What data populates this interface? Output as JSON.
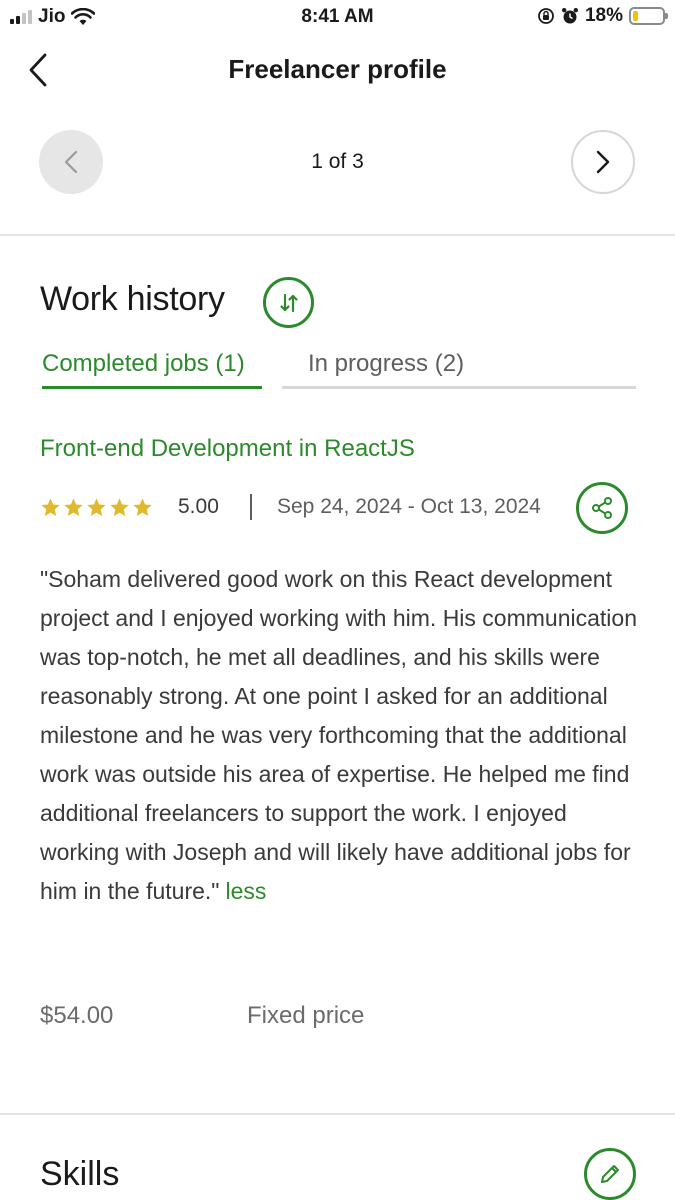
{
  "status_bar": {
    "carrier": "Jio",
    "time": "8:41 AM",
    "battery_percent": "18%",
    "battery_level": 0.18,
    "icons": [
      "signal-icon",
      "wifi-icon",
      "orientation-lock-icon",
      "alarm-icon",
      "battery-icon"
    ]
  },
  "header": {
    "title": "Freelancer profile",
    "back_icon": "chevron-left-icon"
  },
  "pager": {
    "text": "1 of 3",
    "prev_icon": "chevron-left-icon",
    "next_icon": "chevron-right-icon"
  },
  "work_history": {
    "title": "Work history",
    "sort_icon": "sort-arrows-icon",
    "tabs": [
      {
        "label": "Completed jobs (1)",
        "active": true
      },
      {
        "label": "In progress (2)",
        "active": false
      }
    ],
    "job": {
      "title": "Front-end Development in ReactJS",
      "stars": 5,
      "rating": "5.00",
      "dates": "Sep 24, 2024 - Oct 13, 2024",
      "share_icon": "share-icon",
      "review": "\"Soham delivered good work on this React development project and I enjoyed working with him. His communication was top-notch, he met all deadlines, and his skills were reasonably strong. At one point I asked for an additional milestone and he was very forthcoming that the additional work was outside his area of expertise. He helped me find additional freelancers to support the work. I enjoyed working with Joseph and will likely have additional jobs for him in the future.\"",
      "less_label": "less",
      "price": "$54.00",
      "price_type": "Fixed price"
    }
  },
  "skills": {
    "title": "Skills",
    "edit_icon": "pencil-icon"
  },
  "colors": {
    "accent_green": "#2c8a2c",
    "star_gold": "#e0b92c",
    "battery_yellow": "#f2c200"
  }
}
